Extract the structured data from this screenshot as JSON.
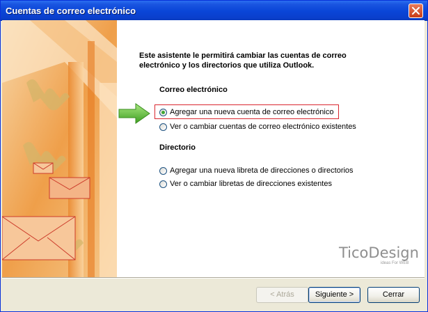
{
  "window": {
    "title": "Cuentas de correo electrónico"
  },
  "intro_text": "Este asistente le permitirá cambiar las cuentas de correo electrónico y los directorios que utiliza Outlook.",
  "email_section": {
    "title": "Correo electrónico",
    "options": [
      {
        "label": "Agregar una nueva cuenta de correo electrónico",
        "selected": true
      },
      {
        "label": "Ver o cambiar cuentas de correo electrónico existentes",
        "selected": false
      }
    ]
  },
  "directory_section": {
    "title": "Directorio",
    "options": [
      {
        "label": "Agregar una nueva libreta de direcciones o directorios",
        "selected": false
      },
      {
        "label": "Ver o cambiar libretas de direcciones existentes",
        "selected": false
      }
    ]
  },
  "watermark": {
    "title": "TicoDesign",
    "subtitle": "ideas For WEB"
  },
  "buttons": {
    "back": "< Atrás",
    "next": "Siguiente >",
    "close": "Cerrar"
  },
  "colors": {
    "titlebar": "#0a46d8",
    "highlight_border": "#d9262e",
    "arrow": "#5cc23a",
    "selected_radio": "#3fa634"
  },
  "icons": {
    "close": "close-icon",
    "arrow": "arrow-right-icon"
  }
}
